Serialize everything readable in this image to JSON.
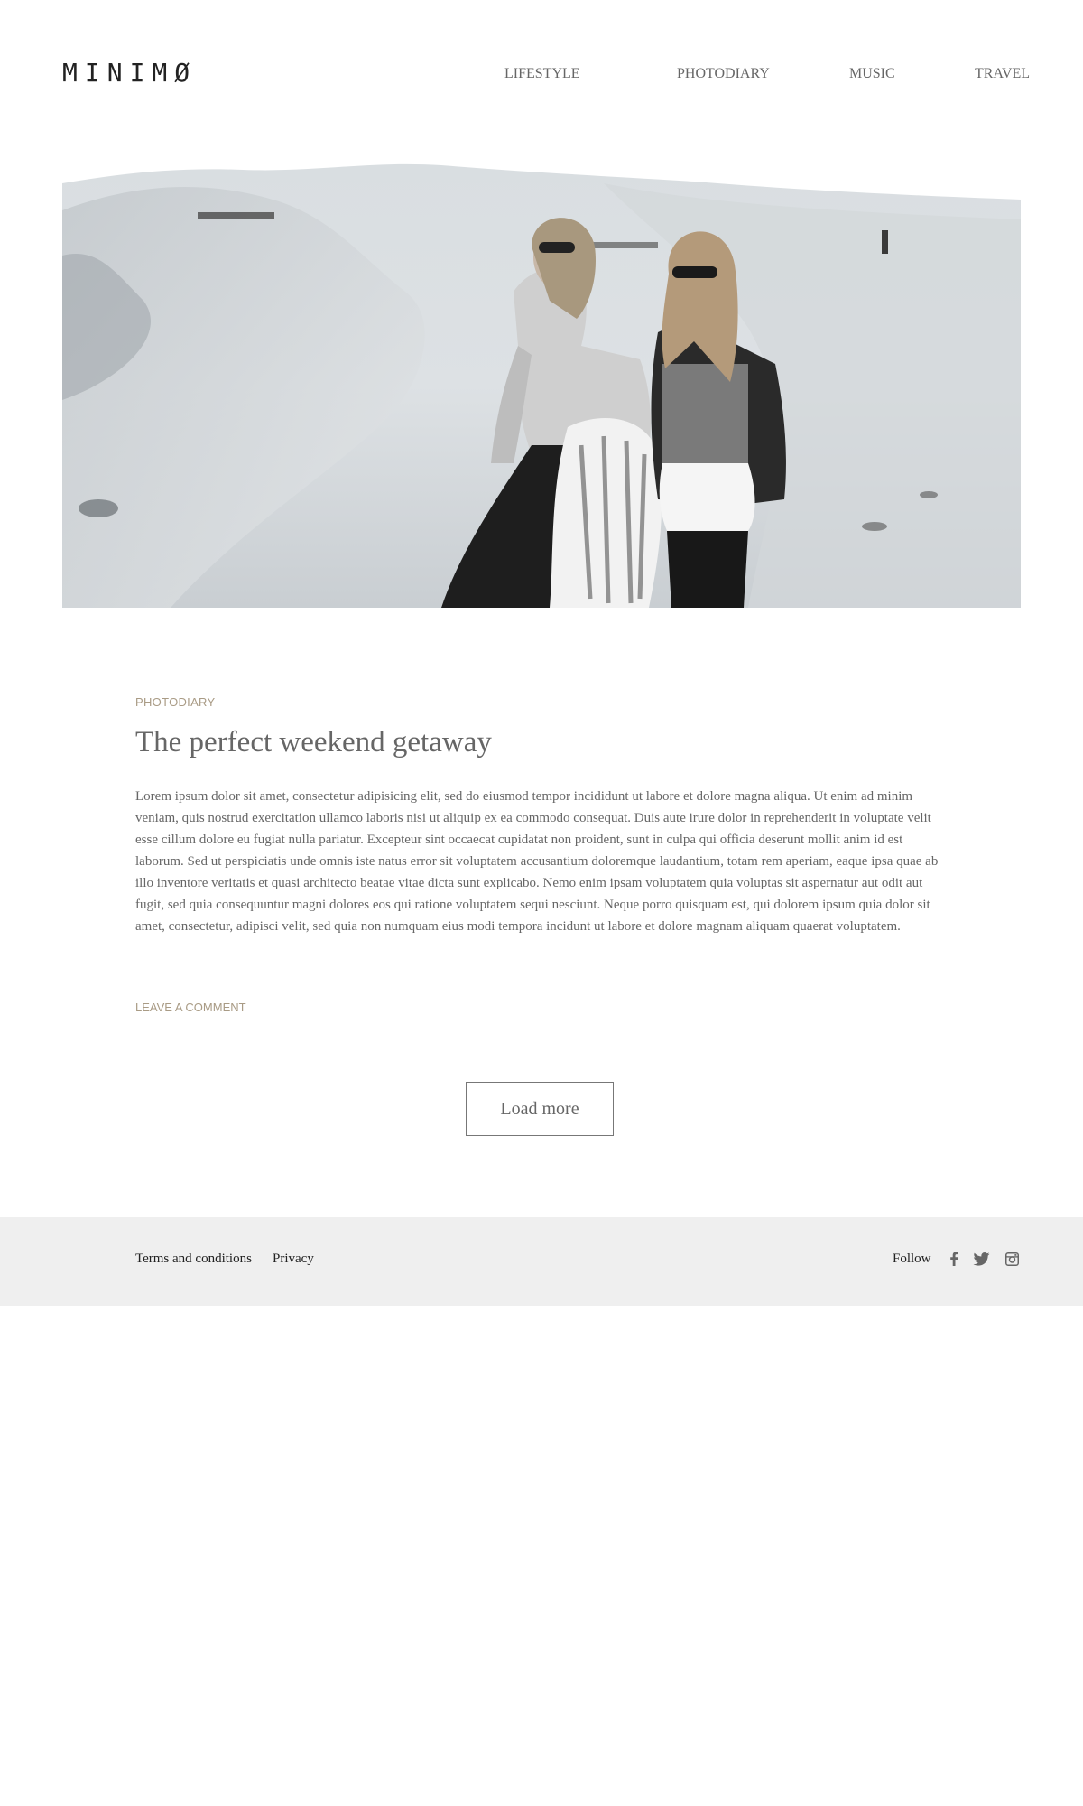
{
  "header": {
    "logo": "MINIMØ",
    "nav": [
      "LIFESTYLE",
      "PHOTODIARY",
      "MUSIC",
      "TRAVEL"
    ]
  },
  "post": {
    "category": "PHOTODIARY",
    "title": "The perfect weekend getaway",
    "body": "Lorem ipsum dolor sit amet, consectetur adipisicing elit, sed do eiusmod tempor incididunt ut labore et dolore magna aliqua. Ut enim ad minim veniam, quis nostrud exercitation ullamco laboris nisi ut aliquip ex ea commodo consequat. Duis aute irure dolor in reprehenderit in voluptate velit esse cillum dolore eu fugiat nulla pariatur. Excepteur sint occaecat cupidatat non proident, sunt in culpa qui officia deserunt mollit anim id est laborum. Sed ut perspiciatis unde omnis iste natus error sit voluptatem accusantium doloremque laudantium, totam rem aperiam, eaque ipsa quae ab illo inventore veritatis et quasi architecto beatae vitae dicta sunt explicabo. Nemo enim ipsam voluptatem quia voluptas sit aspernatur aut odit aut fugit, sed quia consequuntur magni dolores eos qui ratione voluptatem sequi nesciunt. Neque porro quisquam est, qui dolorem ipsum quia dolor sit amet, consectetur, adipisci velit, sed quia non numquam eius modi tempora incidunt ut labore et dolore magnam aliquam quaerat voluptatem.",
    "comment_link": "LEAVE A COMMENT"
  },
  "load_more": "Load more",
  "footer": {
    "terms": "Terms and conditions",
    "privacy": "Privacy",
    "follow": "Follow",
    "social_icons": [
      "facebook-icon",
      "twitter-icon",
      "instagram-icon"
    ]
  },
  "colors": {
    "accent": "#a99b85",
    "text": "#666666",
    "footer_bg": "#efefef"
  }
}
